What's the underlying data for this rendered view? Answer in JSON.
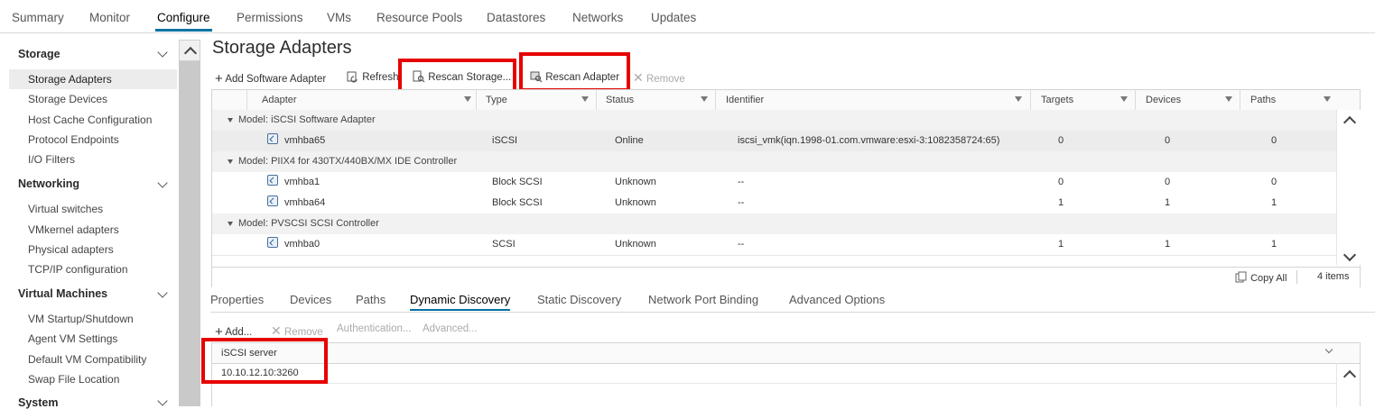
{
  "top_tabs": [
    "Summary",
    "Monitor",
    "Configure",
    "Permissions",
    "VMs",
    "Resource Pools",
    "Datastores",
    "Networks",
    "Updates"
  ],
  "sidebar": {
    "storage": {
      "title": "Storage",
      "items": [
        "Storage Adapters",
        "Storage Devices",
        "Host Cache Configuration",
        "Protocol Endpoints",
        "I/O Filters"
      ]
    },
    "networking": {
      "title": "Networking",
      "items": [
        "Virtual switches",
        "VMkernel adapters",
        "Physical adapters",
        "TCP/IP configuration"
      ]
    },
    "virtual_machines": {
      "title": "Virtual Machines",
      "items": [
        "VM Startup/Shutdown",
        "Agent VM Settings",
        "Default VM Compatibility",
        "Swap File Location"
      ]
    },
    "system": {
      "title": "System"
    }
  },
  "page_title": "Storage Adapters",
  "toolbar": {
    "add_software_adapter": "Add Software Adapter",
    "refresh": "Refresh",
    "rescan_storage": "Rescan Storage...",
    "rescan_adapter": "Rescan Adapter",
    "remove": "Remove"
  },
  "grid": {
    "columns": [
      "Adapter",
      "Type",
      "Status",
      "Identifier",
      "Targets",
      "Devices",
      "Paths"
    ],
    "groups": [
      {
        "label": "Model: iSCSI Software Adapter",
        "rows": [
          {
            "adapter": "vmhba65",
            "type": "iSCSI",
            "status": "Online",
            "identifier": "iscsi_vmk(iqn.1998-01.com.vmware:esxi-3:1082358724:65)",
            "targets": "0",
            "devices": "0",
            "paths": "0"
          }
        ]
      },
      {
        "label": "Model: PIIX4 for 430TX/440BX/MX IDE Controller",
        "rows": [
          {
            "adapter": "vmhba1",
            "type": "Block SCSI",
            "status": "Unknown",
            "identifier": "--",
            "targets": "0",
            "devices": "0",
            "paths": "0"
          },
          {
            "adapter": "vmhba64",
            "type": "Block SCSI",
            "status": "Unknown",
            "identifier": "--",
            "targets": "1",
            "devices": "1",
            "paths": "1"
          }
        ]
      },
      {
        "label": "Model: PVSCSI SCSI Controller",
        "rows": [
          {
            "adapter": "vmhba0",
            "type": "SCSI",
            "status": "Unknown",
            "identifier": "--",
            "targets": "1",
            "devices": "1",
            "paths": "1"
          }
        ]
      }
    ],
    "footer": {
      "copy_all": "Copy All",
      "count": "4 items"
    }
  },
  "bottom_tabs": [
    "Properties",
    "Devices",
    "Paths",
    "Dynamic Discovery",
    "Static Discovery",
    "Network Port Binding",
    "Advanced Options"
  ],
  "discovery_toolbar": {
    "add": "Add...",
    "remove": "Remove",
    "authentication": "Authentication...",
    "advanced": "Advanced..."
  },
  "server_list": {
    "column": "iSCSI server",
    "rows": [
      "10.10.12.10:3260"
    ]
  },
  "colors": {
    "accent": "#0072a3",
    "highlight_box": "#e60000"
  }
}
